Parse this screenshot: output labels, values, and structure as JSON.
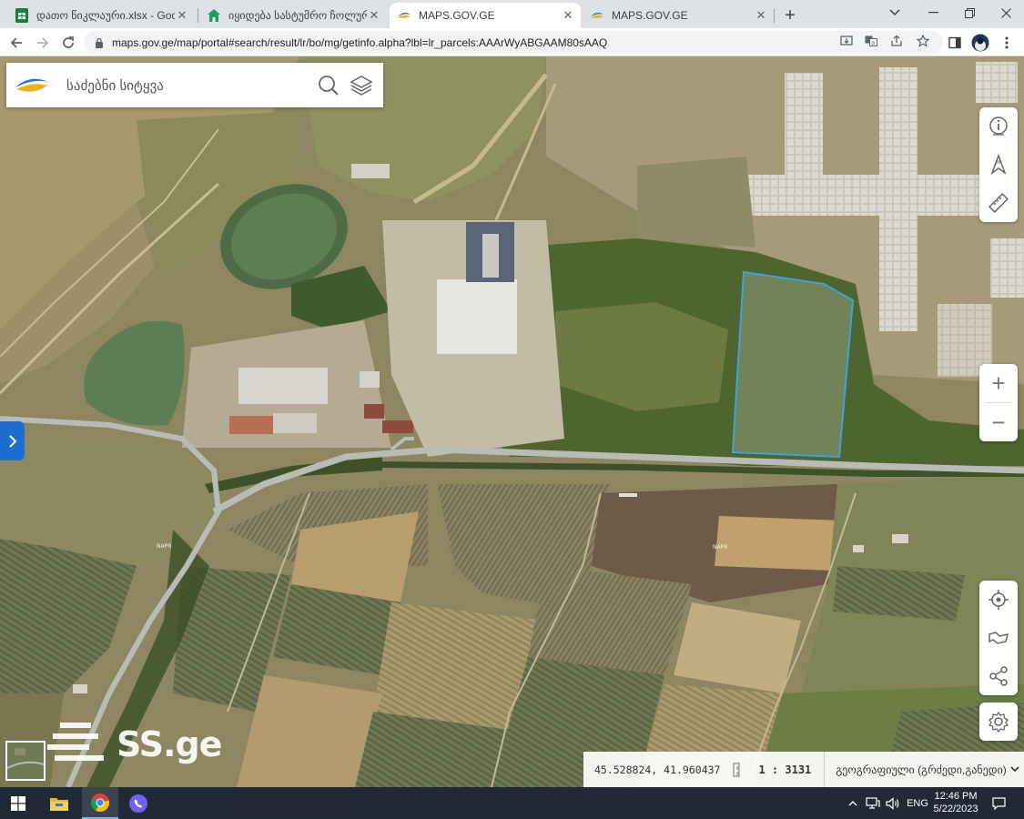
{
  "browser": {
    "tabs": [
      {
        "title": "დათო წიკლაური.xlsx - Google Sheets",
        "icon": "sheets-icon",
        "active": false
      },
      {
        "title": "იყიდება სასტუმრო ჩოლურგი",
        "icon": "ss-home-icon",
        "active": false
      },
      {
        "title": "MAPS.GOV.GE",
        "icon": "maps-gov-icon",
        "active": true
      },
      {
        "title": "MAPS.GOV.GE",
        "icon": "maps-gov-icon",
        "active": false
      }
    ],
    "url": "maps.gov.ge/map/portal#search/result/lr/bo/mg/getinfo.alpha?lbl=lr_parcels:AAArWyABGAAM80sAAQ"
  },
  "map": {
    "search_placeholder": "საძებნი სიტყვა",
    "coordinates": "45.528824, 41.960437",
    "scale": "1 : 3131",
    "projection": "გეოგრაფიული (გრძედი,განედი)",
    "watermark": "SS.ge",
    "napr_label_1": "NAPR",
    "napr_label_2": "NAPR",
    "colors": {
      "parcel_outline": "#3fa3d8",
      "sidebar_toggle": "#1f6fd1",
      "road": "#b9bcb6"
    },
    "right_controls_top": [
      "info-icon",
      "compass-icon",
      "measure-icon"
    ],
    "zoom": [
      "+",
      "−"
    ],
    "right_controls_bottom": [
      "locate-icon",
      "draw-icon",
      "share-icon",
      "settings-icon"
    ]
  },
  "taskbar": {
    "language": "ENG",
    "time": "12:46 PM",
    "date": "5/22/2023"
  }
}
